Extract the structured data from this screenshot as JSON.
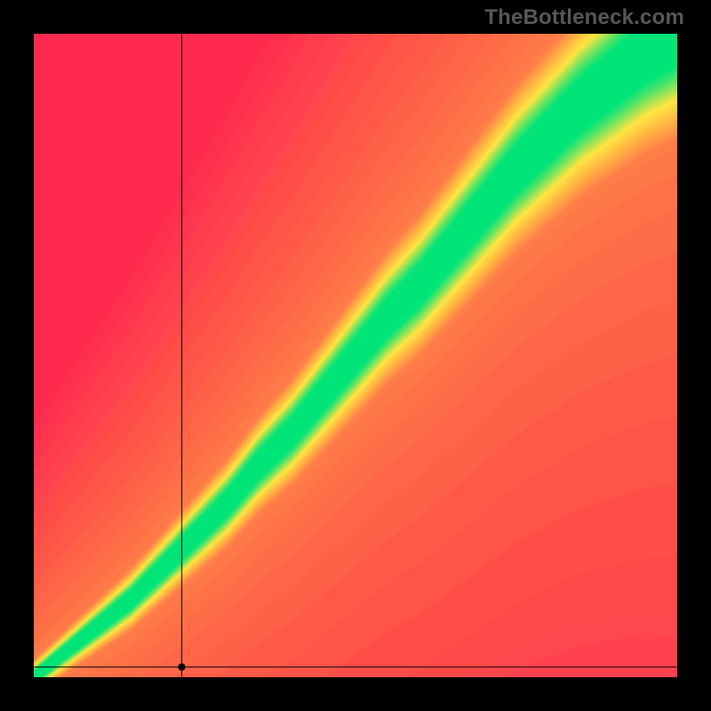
{
  "watermark": "TheBottleneck.com",
  "colors": {
    "bg_black": "#000000",
    "red": "#ff2a4d",
    "yellow": "#ffe640",
    "green": "#00e37a",
    "axis": "#000000",
    "watermark": "#575757"
  },
  "axes": {
    "marker_x_fraction": 0.23
  },
  "chart_data": {
    "type": "heatmap",
    "title": "",
    "xlabel": "",
    "ylabel": "",
    "xlim": [
      0,
      1
    ],
    "ylim": [
      0,
      1
    ],
    "description": "Bottleneck compatibility heatmap. Both axes are normalized 0–1. The ridge of best match (green) runs roughly along y = f(x), a slightly super-linear diagonal. Distance from the ridge controls color: near → green, mid → yellow, far → red.",
    "ridge": {
      "x": [
        0.0,
        0.05,
        0.1,
        0.15,
        0.2,
        0.25,
        0.3,
        0.35,
        0.4,
        0.45,
        0.5,
        0.55,
        0.6,
        0.65,
        0.7,
        0.75,
        0.8,
        0.85,
        0.9,
        0.95,
        1.0
      ],
      "y": [
        0.0,
        0.04,
        0.08,
        0.12,
        0.17,
        0.22,
        0.27,
        0.33,
        0.38,
        0.44,
        0.5,
        0.56,
        0.61,
        0.67,
        0.73,
        0.79,
        0.84,
        0.89,
        0.93,
        0.97,
        1.0
      ]
    },
    "green_band_halfwidth_y": 0.045,
    "yellow_band_halfwidth_y": 0.11,
    "marker_point": {
      "x": 0.23,
      "y": 0.0
    }
  }
}
